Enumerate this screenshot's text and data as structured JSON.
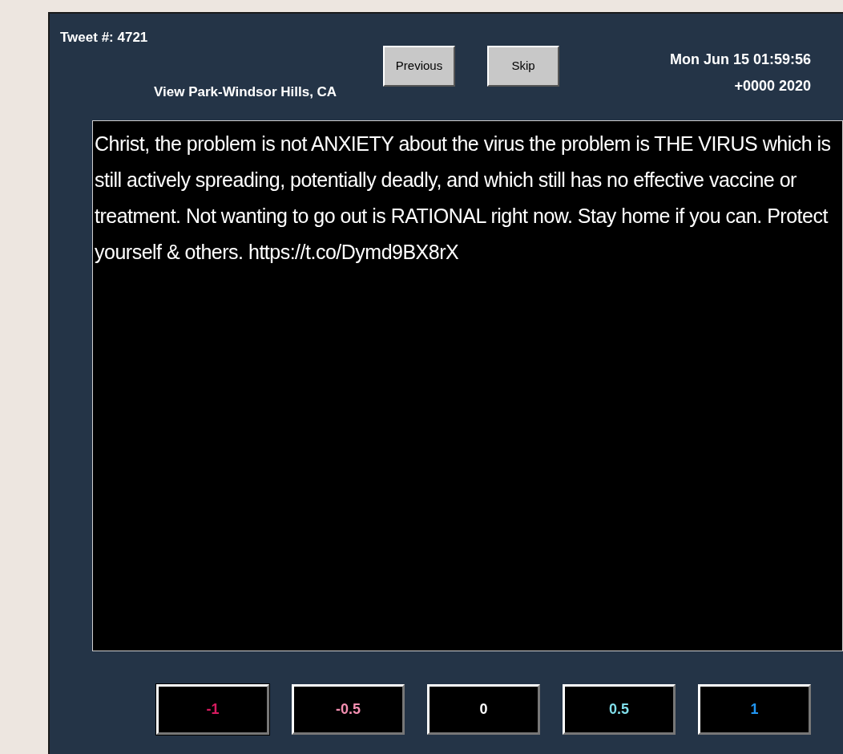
{
  "header": {
    "tweet_number": "Tweet #: 4721",
    "location": "View Park-Windsor Hills, CA",
    "date_line_1": "Mon Jun 15 01:59:56",
    "date_line_2": "+0000 2020"
  },
  "buttons": [
    "Previous",
    "Skip"
  ],
  "tweet_text": "Christ, the problem is not ANXIETY about the virus the problem is THE VIRUS which is still actively spreading, potentially deadly, and which still has no effective vaccine or treatment. Not wanting to go out is RATIONAL right now. Stay home if you can. Protect yourself & others. https://t.co/Dymd9BX8rX",
  "ratings": [
    {
      "label": "-1",
      "color": "#d81b60",
      "selected": true
    },
    {
      "label": "-0.5",
      "color": "#f48fb1",
      "selected": false
    },
    {
      "label": "0",
      "color": "#ffffff",
      "selected": false
    },
    {
      "label": "0.5",
      "color": "#80deea",
      "selected": false
    },
    {
      "label": "1",
      "color": "#2196f3",
      "selected": false
    }
  ]
}
